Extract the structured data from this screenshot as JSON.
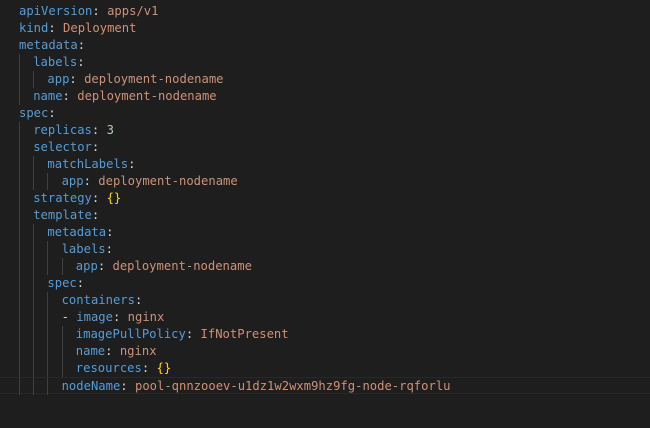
{
  "editor": {
    "lines": [
      {
        "key": "apiVersion",
        "value": "apps/v1",
        "vtype": "str"
      },
      {
        "key": "kind",
        "value": "Deployment",
        "vtype": "str"
      },
      {
        "key": "metadata",
        "value": "",
        "vtype": "none"
      },
      {
        "key": "labels",
        "value": "",
        "vtype": "none"
      },
      {
        "key": "app",
        "value": "deployment-nodename",
        "vtype": "str"
      },
      {
        "key": "name",
        "value": "deployment-nodename",
        "vtype": "str"
      },
      {
        "key": "spec",
        "value": "",
        "vtype": "none"
      },
      {
        "key": "replicas",
        "value": "3",
        "vtype": "num"
      },
      {
        "key": "selector",
        "value": "",
        "vtype": "none"
      },
      {
        "key": "matchLabels",
        "value": "",
        "vtype": "none"
      },
      {
        "key": "app",
        "value": "deployment-nodename",
        "vtype": "str"
      },
      {
        "key": "strategy",
        "value": "{}",
        "vtype": "brace"
      },
      {
        "key": "template",
        "value": "",
        "vtype": "none"
      },
      {
        "key": "metadata",
        "value": "",
        "vtype": "none"
      },
      {
        "key": "labels",
        "value": "",
        "vtype": "none"
      },
      {
        "key": "app",
        "value": "deployment-nodename",
        "vtype": "str"
      },
      {
        "key": "spec",
        "value": "",
        "vtype": "none"
      },
      {
        "key": "containers",
        "value": "",
        "vtype": "none"
      },
      {
        "key": "image",
        "value": "nginx",
        "vtype": "str",
        "dash": "- "
      },
      {
        "key": "imagePullPolicy",
        "value": "IfNotPresent",
        "vtype": "str"
      },
      {
        "key": "name",
        "value": "nginx",
        "vtype": "str"
      },
      {
        "key": "resources",
        "value": "{}",
        "vtype": "brace"
      },
      {
        "key": "nodeName",
        "value": "pool-qnnzooev-u1dz1w2wxm9hz9fg-node-rqforlu",
        "vtype": "str"
      }
    ]
  }
}
